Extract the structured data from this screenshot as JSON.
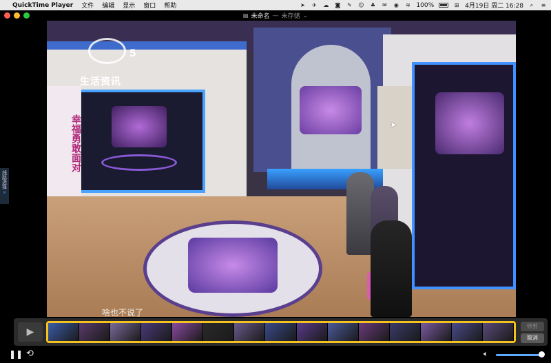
{
  "menubar": {
    "app_name": "QuickTime Player",
    "menus": [
      "文件",
      "编辑",
      "显示",
      "窗口",
      "帮助"
    ],
    "battery": "100%",
    "datetime": "4月19日 周二  16:28"
  },
  "window": {
    "title": "未命名",
    "separator": "—",
    "status": "未存储"
  },
  "sidetab": {
    "label": "线路选择",
    "arrows": "»"
  },
  "video": {
    "channel_number": "5",
    "channel_name": "生活资讯",
    "side_banner": "幸福勇敢面对",
    "caption": "啥也不说了"
  },
  "controls": {
    "trim_label": "修剪",
    "cancel_label": "取消",
    "thumbnail_colors": [
      "#3a5ca8",
      "#5a3a6a",
      "#7a6a9a",
      "#4a3a7a",
      "#8a4aa0",
      "#2a2a2a",
      "#6a5a8a",
      "#3a4a8a",
      "#5a3a8a",
      "#4a5a9a",
      "#6a3a7a",
      "#3a3a6a",
      "#7a5aa0",
      "#4a4a8a",
      "#5a4a7a"
    ]
  },
  "volume": {
    "level": 0.95
  }
}
